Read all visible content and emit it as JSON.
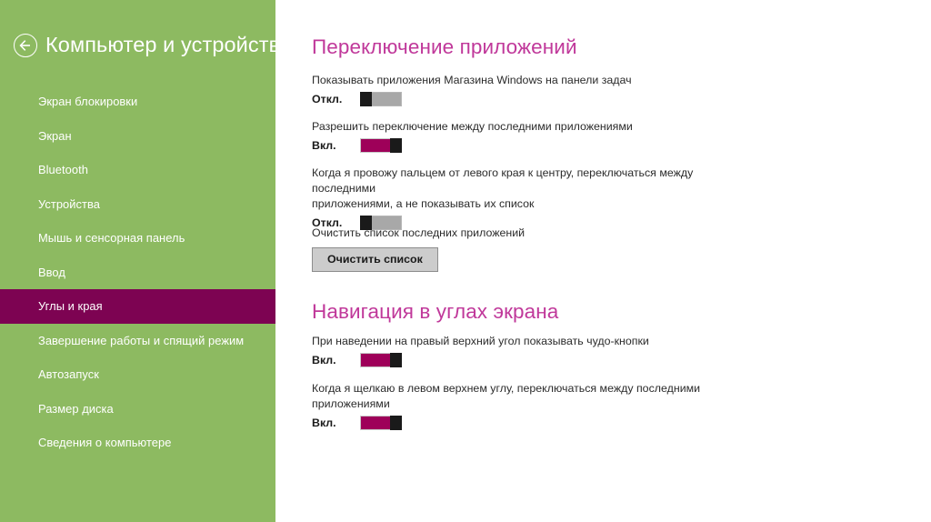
{
  "sidebar": {
    "title": "Компьютер и устройства",
    "back_icon": "back-arrow-icon",
    "search_icon": "search-icon",
    "items": [
      {
        "label": "Экран блокировки",
        "selected": false
      },
      {
        "label": "Экран",
        "selected": false
      },
      {
        "label": "Bluetooth",
        "selected": false
      },
      {
        "label": "Устройства",
        "selected": false
      },
      {
        "label": "Мышь и сенсорная панель",
        "selected": false
      },
      {
        "label": "Ввод",
        "selected": false
      },
      {
        "label": "Углы и края",
        "selected": true
      },
      {
        "label": "Завершение работы и спящий режим",
        "selected": false
      },
      {
        "label": "Автозапуск",
        "selected": false
      },
      {
        "label": "Размер диска",
        "selected": false
      },
      {
        "label": "Сведения о компьютере",
        "selected": false
      }
    ],
    "colors": {
      "background": "#8dba61",
      "selected_background": "#7d0352",
      "text": "#ffffff"
    }
  },
  "main": {
    "sections": [
      {
        "id": "app-switching",
        "title": "Переключение приложений",
        "settings": [
          {
            "id": "taskbar-apps",
            "label": "Показывать приложения Магазина Windows на панели задач",
            "state_label": "Откл.",
            "state": "off"
          },
          {
            "id": "switch-recent",
            "label": "Разрешить переключение между последними приложениями",
            "state_label": "Вкл.",
            "state": "on"
          },
          {
            "id": "swipe-edge",
            "label": "Когда я провожу пальцем от левого края к центру, переключаться между последними\nприложениями, а не показывать их список",
            "state_label": "Откл.",
            "state": "off"
          },
          {
            "id": "clear-list",
            "label": "Очистить список последних приложений",
            "button_label": "Очистить список"
          }
        ]
      },
      {
        "id": "corner-navigation",
        "title": "Навигация в углах экрана",
        "settings": [
          {
            "id": "charms-corner",
            "label": "При наведении на правый верхний угол показывать чудо-кнопки",
            "state_label": "Вкл.",
            "state": "on"
          },
          {
            "id": "topleft-click",
            "label": "Когда я щелкаю в левом верхнем углу, переключаться между последними приложениями",
            "state_label": "Вкл.",
            "state": "on"
          }
        ]
      }
    ],
    "colors": {
      "heading": "#c0389a",
      "toggle_on": "#9e0059",
      "toggle_off_track": "#a8a8a8",
      "toggle_knob": "#1a1a1a",
      "button_background": "#cccccc"
    }
  }
}
